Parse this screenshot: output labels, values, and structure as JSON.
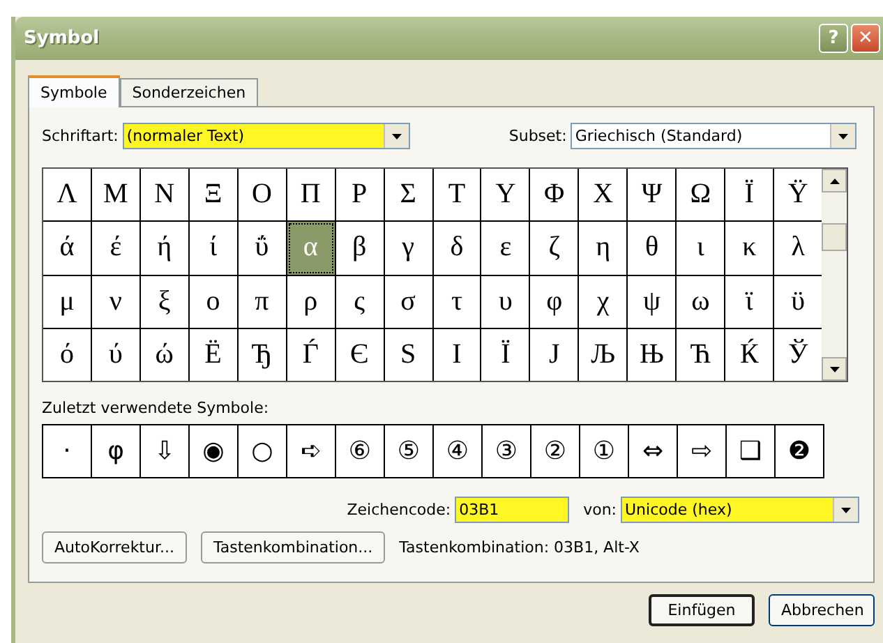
{
  "window": {
    "title": "Symbol",
    "buttons": [
      {
        "kind": "help",
        "label": "?"
      },
      {
        "kind": "close",
        "label": "✕"
      }
    ]
  },
  "tabs": [
    {
      "label": "Symbole",
      "selected": true
    },
    {
      "label": "Sonderzeichen",
      "selected": false
    }
  ],
  "font_field": {
    "label": "Schriftart:",
    "value": "(normaler Text)",
    "highlighted": true
  },
  "subset_field": {
    "label": "Subset:",
    "value": "Griechisch (Standard)",
    "highlighted": false
  },
  "symbols": [
    [
      {
        "char": "Λ",
        "selected": false
      },
      {
        "char": "Μ",
        "selected": false
      },
      {
        "char": "Ν",
        "selected": false
      },
      {
        "char": "Ξ",
        "selected": false
      },
      {
        "char": "Ο",
        "selected": false
      },
      {
        "char": "Π",
        "selected": false
      },
      {
        "char": "Ρ",
        "selected": false
      },
      {
        "char": "Σ",
        "selected": false
      },
      {
        "char": "Τ",
        "selected": false
      },
      {
        "char": "Υ",
        "selected": false
      },
      {
        "char": "Φ",
        "selected": false
      },
      {
        "char": "Χ",
        "selected": false
      },
      {
        "char": "Ψ",
        "selected": false
      },
      {
        "char": "Ω",
        "selected": false
      },
      {
        "char": "Ϊ",
        "selected": false
      },
      {
        "char": "Ϋ",
        "selected": false
      }
    ],
    [
      {
        "char": "ά",
        "selected": false
      },
      {
        "char": "έ",
        "selected": false
      },
      {
        "char": "ή",
        "selected": false
      },
      {
        "char": "ί",
        "selected": false
      },
      {
        "char": "ΰ",
        "selected": false
      },
      {
        "char": "α",
        "selected": true
      },
      {
        "char": "β",
        "selected": false
      },
      {
        "char": "γ",
        "selected": false
      },
      {
        "char": "δ",
        "selected": false
      },
      {
        "char": "ε",
        "selected": false
      },
      {
        "char": "ζ",
        "selected": false
      },
      {
        "char": "η",
        "selected": false
      },
      {
        "char": "θ",
        "selected": false
      },
      {
        "char": "ι",
        "selected": false
      },
      {
        "char": "κ",
        "selected": false
      },
      {
        "char": "λ",
        "selected": false
      }
    ],
    [
      {
        "char": "μ",
        "selected": false
      },
      {
        "char": "ν",
        "selected": false
      },
      {
        "char": "ξ",
        "selected": false
      },
      {
        "char": "ο",
        "selected": false
      },
      {
        "char": "π",
        "selected": false
      },
      {
        "char": "ρ",
        "selected": false
      },
      {
        "char": "ς",
        "selected": false
      },
      {
        "char": "σ",
        "selected": false
      },
      {
        "char": "τ",
        "selected": false
      },
      {
        "char": "υ",
        "selected": false
      },
      {
        "char": "φ",
        "selected": false
      },
      {
        "char": "χ",
        "selected": false
      },
      {
        "char": "ψ",
        "selected": false
      },
      {
        "char": "ω",
        "selected": false
      },
      {
        "char": "ϊ",
        "selected": false
      },
      {
        "char": "ϋ",
        "selected": false
      }
    ],
    [
      {
        "char": "ό",
        "selected": false
      },
      {
        "char": "ύ",
        "selected": false
      },
      {
        "char": "ώ",
        "selected": false
      },
      {
        "char": "Ё",
        "selected": false
      },
      {
        "char": "Ђ",
        "selected": false
      },
      {
        "char": "Ѓ",
        "selected": false
      },
      {
        "char": "Є",
        "selected": false
      },
      {
        "char": "Ѕ",
        "selected": false
      },
      {
        "char": "І",
        "selected": false
      },
      {
        "char": "Ї",
        "selected": false
      },
      {
        "char": "Ј",
        "selected": false
      },
      {
        "char": "Љ",
        "selected": false
      },
      {
        "char": "Њ",
        "selected": false
      },
      {
        "char": "Ћ",
        "selected": false
      },
      {
        "char": "Ќ",
        "selected": false
      },
      {
        "char": "Ў",
        "selected": false
      }
    ]
  ],
  "recent_label": "Zuletzt verwendete Symbole:",
  "recent_symbols": [
    "·",
    "φ",
    "⇩",
    "◉",
    "○",
    "➪",
    "⑥",
    "⑤",
    "④",
    "③",
    "②",
    "①",
    "⇔",
    "⇨",
    "❑",
    "❷"
  ],
  "char_code": {
    "label": "Zeichencode:",
    "value": "03B1",
    "highlighted": true
  },
  "from_field": {
    "label": "von:",
    "value": "Unicode (hex)",
    "highlighted": true
  },
  "action_buttons": [
    "AutoKorrektur...",
    "Tastenkombination..."
  ],
  "shortcut_text": "Tastenkombination: 03B1, Alt-X",
  "dialog_buttons": [
    {
      "label": "Einfügen",
      "default": true
    },
    {
      "label": "Abbrechen",
      "default": false
    }
  ]
}
